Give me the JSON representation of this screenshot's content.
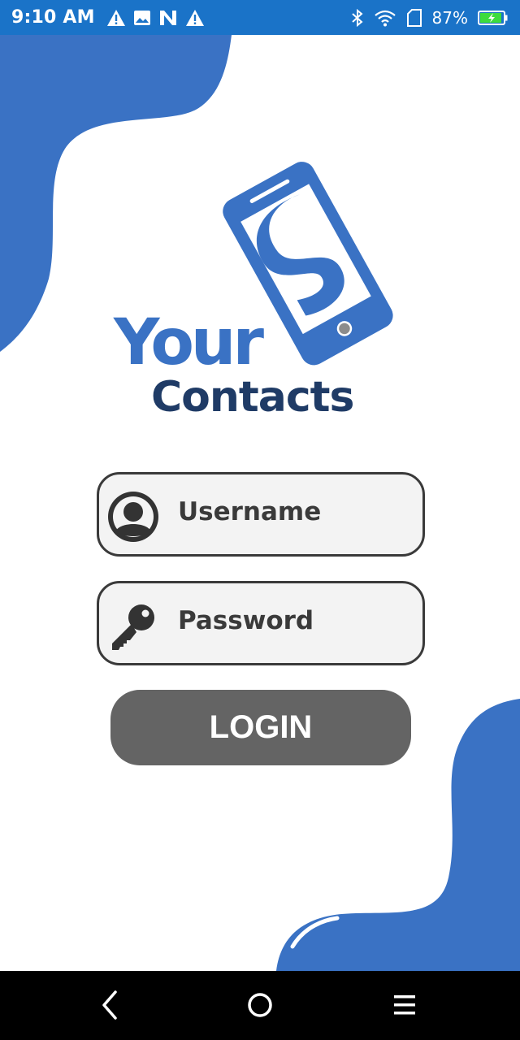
{
  "status_bar": {
    "time": "9:10 AM",
    "battery_percent": "87%",
    "notification_icons": [
      "warning-icon",
      "image-icon",
      "n-app-icon",
      "warning-icon"
    ],
    "system_icons": [
      "bluetooth-icon",
      "wifi-icon",
      "sim-icon",
      "battery-charging-icon"
    ],
    "background_color": "#1a73c8"
  },
  "logo": {
    "line1": "Your",
    "line2": "Contacts",
    "primary_color": "#3a72c4",
    "secondary_color": "#1f3b66"
  },
  "form": {
    "username_placeholder": "Username",
    "password_placeholder": "Password",
    "login_label": "LOGIN",
    "button_color": "#646464"
  },
  "nav_bar": {
    "buttons": [
      "back-icon",
      "home-icon",
      "menu-icon"
    ]
  },
  "theme": {
    "accent": "#3a72c4"
  }
}
